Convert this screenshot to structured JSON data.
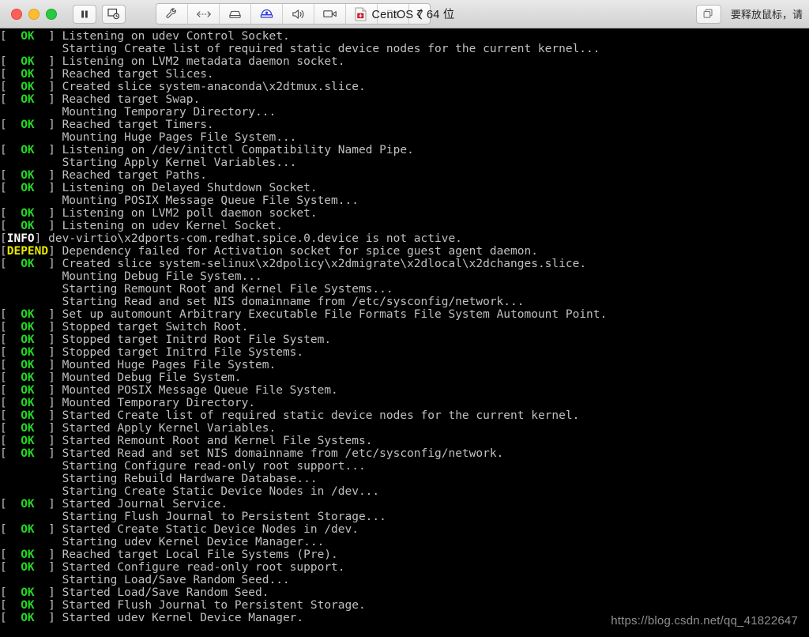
{
  "window": {
    "title": "CentOS 7 64 位",
    "title_icon": "vm-document-icon",
    "traffic_lights": [
      "close",
      "minimize",
      "maximize"
    ],
    "left_buttons": [
      {
        "name": "pause-button",
        "icon": "pause-icon",
        "glyph": "❙❙"
      },
      {
        "name": "snapshot-button",
        "icon": "snapshot-icon",
        "glyph": "⎙"
      }
    ],
    "device_toolbar": [
      {
        "name": "settings-button",
        "icon": "wrench-icon",
        "state": "enabled"
      },
      {
        "name": "network-button",
        "icon": "network-icon",
        "state": "enabled"
      },
      {
        "name": "harddisk-button",
        "icon": "harddisk-icon",
        "state": "enabled"
      },
      {
        "name": "camera-button",
        "icon": "camera-icon",
        "state": "active"
      },
      {
        "name": "sound-button",
        "icon": "speaker-icon",
        "state": "enabled"
      },
      {
        "name": "video-button",
        "icon": "videocamera-icon",
        "state": "enabled"
      },
      {
        "name": "usb-button",
        "icon": "usb-icon",
        "state": "disabled"
      },
      {
        "name": "shared-folder-button",
        "icon": "shared-folder-icon",
        "state": "disabled"
      },
      {
        "name": "collapse-button",
        "icon": "chevron-left-icon",
        "state": "enabled"
      }
    ],
    "right": {
      "fullscreen_icon": "window-restore-icon",
      "hint": "要释放鼠标，请"
    }
  },
  "console": {
    "watermark": "https://blog.csdn.net/qq_41822647",
    "status_labels": {
      "ok": "OK",
      "info": "INFO",
      "depend": "DEPEND"
    },
    "lines": [
      {
        "status": "ok",
        "text": "Listening on udev Control Socket."
      },
      {
        "status": "none",
        "text": "Starting Create list of required static device nodes for the current kernel..."
      },
      {
        "status": "ok",
        "text": "Listening on LVM2 metadata daemon socket."
      },
      {
        "status": "ok",
        "text": "Reached target Slices."
      },
      {
        "status": "ok",
        "text": "Created slice system-anaconda\\x2dtmux.slice."
      },
      {
        "status": "ok",
        "text": "Reached target Swap."
      },
      {
        "status": "none",
        "text": "Mounting Temporary Directory..."
      },
      {
        "status": "ok",
        "text": "Reached target Timers."
      },
      {
        "status": "none",
        "text": "Mounting Huge Pages File System..."
      },
      {
        "status": "ok",
        "text": "Listening on /dev/initctl Compatibility Named Pipe."
      },
      {
        "status": "none",
        "text": "Starting Apply Kernel Variables..."
      },
      {
        "status": "ok",
        "text": "Reached target Paths."
      },
      {
        "status": "ok",
        "text": "Listening on Delayed Shutdown Socket."
      },
      {
        "status": "none",
        "text": "Mounting POSIX Message Queue File System..."
      },
      {
        "status": "ok",
        "text": "Listening on LVM2 poll daemon socket."
      },
      {
        "status": "ok",
        "text": "Listening on udev Kernel Socket."
      },
      {
        "status": "info",
        "text": "dev-virtio\\x2dports-com.redhat.spice.0.device is not active."
      },
      {
        "status": "depend",
        "text": "Dependency failed for Activation socket for spice guest agent daemon."
      },
      {
        "status": "ok",
        "text": "Created slice system-selinux\\x2dpolicy\\x2dmigrate\\x2dlocal\\x2dchanges.slice."
      },
      {
        "status": "none",
        "text": "Mounting Debug File System..."
      },
      {
        "status": "none",
        "text": "Starting Remount Root and Kernel File Systems..."
      },
      {
        "status": "none",
        "text": "Starting Read and set NIS domainname from /etc/sysconfig/network..."
      },
      {
        "status": "ok",
        "text": "Set up automount Arbitrary Executable File Formats File System Automount Point."
      },
      {
        "status": "ok",
        "text": "Stopped target Switch Root."
      },
      {
        "status": "ok",
        "text": "Stopped target Initrd Root File System."
      },
      {
        "status": "ok",
        "text": "Stopped target Initrd File Systems."
      },
      {
        "status": "ok",
        "text": "Mounted Huge Pages File System."
      },
      {
        "status": "ok",
        "text": "Mounted Debug File System."
      },
      {
        "status": "ok",
        "text": "Mounted POSIX Message Queue File System."
      },
      {
        "status": "ok",
        "text": "Mounted Temporary Directory."
      },
      {
        "status": "ok",
        "text": "Started Create list of required static device nodes for the current kernel."
      },
      {
        "status": "ok",
        "text": "Started Apply Kernel Variables."
      },
      {
        "status": "ok",
        "text": "Started Remount Root and Kernel File Systems."
      },
      {
        "status": "ok",
        "text": "Started Read and set NIS domainname from /etc/sysconfig/network."
      },
      {
        "status": "none",
        "text": "Starting Configure read-only root support..."
      },
      {
        "status": "none",
        "text": "Starting Rebuild Hardware Database..."
      },
      {
        "status": "none",
        "text": "Starting Create Static Device Nodes in /dev..."
      },
      {
        "status": "ok",
        "text": "Started Journal Service."
      },
      {
        "status": "none",
        "text": "Starting Flush Journal to Persistent Storage..."
      },
      {
        "status": "ok",
        "text": "Started Create Static Device Nodes in /dev."
      },
      {
        "status": "none",
        "text": "Starting udev Kernel Device Manager..."
      },
      {
        "status": "ok",
        "text": "Reached target Local File Systems (Pre)."
      },
      {
        "status": "ok",
        "text": "Started Configure read-only root support."
      },
      {
        "status": "none",
        "text": "Starting Load/Save Random Seed..."
      },
      {
        "status": "ok",
        "text": "Started Load/Save Random Seed."
      },
      {
        "status": "ok",
        "text": "Started Flush Journal to Persistent Storage."
      },
      {
        "status": "ok",
        "text": "Started udev Kernel Device Manager."
      }
    ]
  }
}
